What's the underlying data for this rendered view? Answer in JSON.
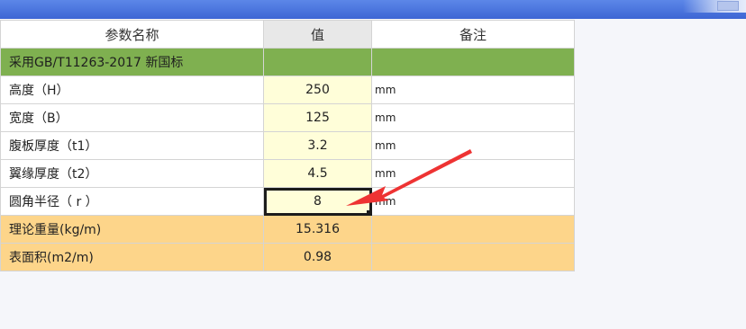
{
  "table": {
    "headers": {
      "name": "参数名称",
      "value": "值",
      "note": "备注"
    },
    "standard": "采用GB/T11263-2017 新国标",
    "inputs": [
      {
        "name": "高度（H）",
        "value": "250",
        "unit": "mm"
      },
      {
        "name": "宽度（B）",
        "value": "125",
        "unit": "mm"
      },
      {
        "name": "腹板厚度（t1）",
        "value": "3.2",
        "unit": "mm"
      },
      {
        "name": "翼缘厚度（t2）",
        "value": "4.5",
        "unit": "mm"
      },
      {
        "name": "圆角半径（ r ）",
        "value": "8",
        "unit": "mm"
      }
    ],
    "results": [
      {
        "name": "理论重量(kg/m)",
        "value": "15.316"
      },
      {
        "name": "表面积(m2/m)",
        "value": "0.98"
      }
    ]
  },
  "colors": {
    "titlebar": "#3d66d4",
    "standard_row": "#7fb050",
    "input_cell": "#fffed9",
    "result_row": "#fdd58a",
    "annotation_arrow": "#ee3333"
  },
  "selected_cell": "圆角半径（ r ）"
}
